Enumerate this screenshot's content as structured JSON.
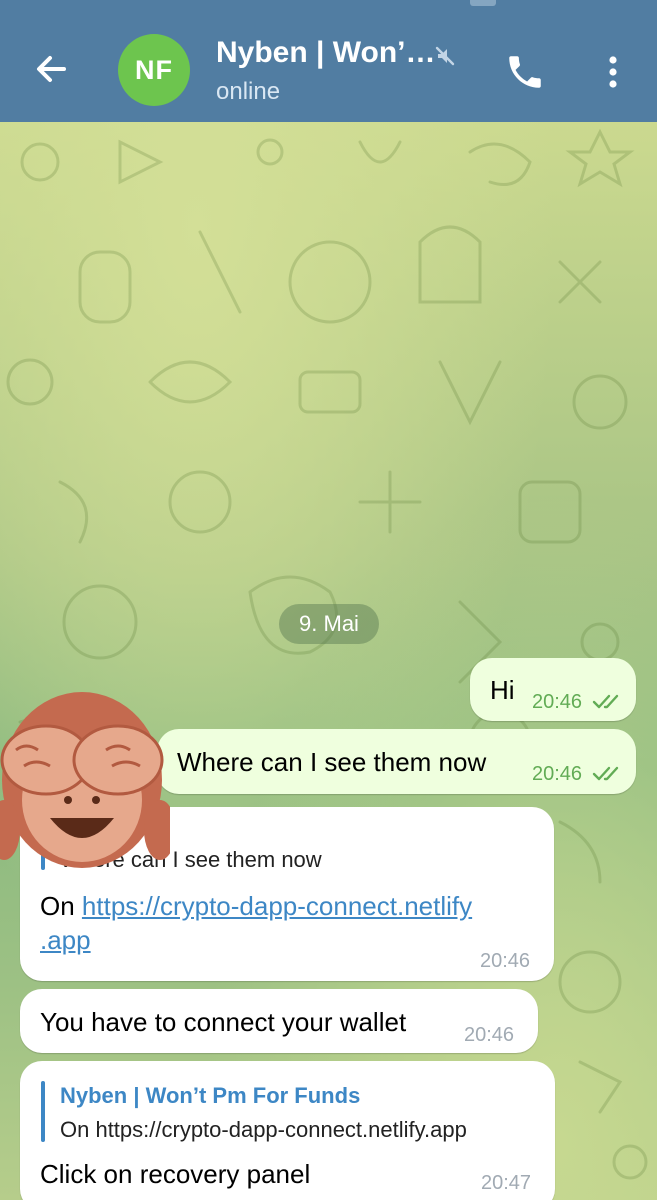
{
  "header": {
    "avatar_initials": "NF",
    "title": "Nyben | Won’…",
    "status": "online",
    "colors": {
      "bar": "#517da2",
      "avatar": "#6dc54e"
    },
    "icons": [
      "back-arrow-icon",
      "muted-icon",
      "phone-icon",
      "more-vertical-icon"
    ]
  },
  "chat": {
    "date": "9. Mai",
    "messages": [
      {
        "direction": "outgoing",
        "text": "Hi",
        "time": "20:46",
        "read": true
      },
      {
        "direction": "outgoing",
        "text": "Where can I see them now",
        "time": "20:46",
        "read": true
      },
      {
        "direction": "incoming",
        "reply_quote": "Where can I see them now",
        "text_prefix": "On ",
        "link_line1": "https://crypto-dapp-connect.netlify",
        "link_line2": ".app",
        "time": "20:46"
      },
      {
        "direction": "incoming",
        "text": "You have to connect your wallet",
        "time": "20:46"
      },
      {
        "direction": "incoming",
        "reply_author": "Nyben | Won’t Pm For Funds",
        "reply_quote": "On https://crypto-dapp-connect.netlify.app",
        "text": "Click on recovery panel",
        "time": "20:47"
      }
    ],
    "sticker": "see-no-evil-monkey-icon"
  }
}
